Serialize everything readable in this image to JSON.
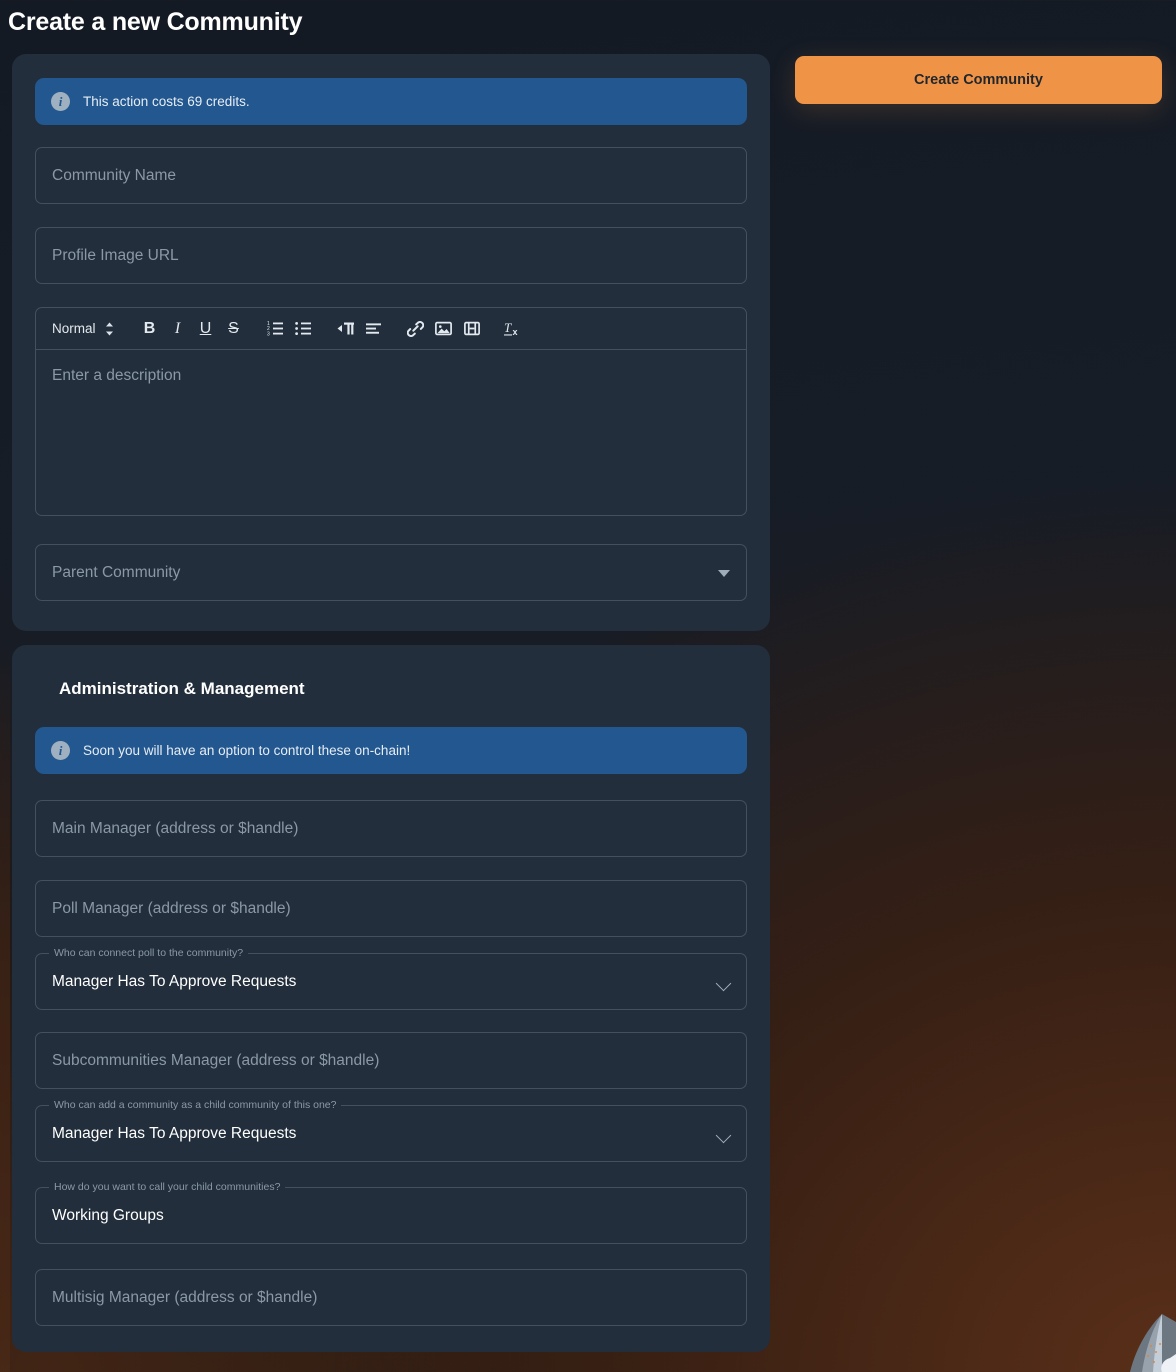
{
  "page": {
    "title": "Create a new Community"
  },
  "basics_card": {
    "info_banner": {
      "icon": "info-icon",
      "message": "This action costs 69 credits."
    },
    "community_name": {
      "placeholder": "Community Name",
      "value": ""
    },
    "profile_image_url": {
      "placeholder": "Profile Image URL",
      "value": ""
    },
    "description_editor": {
      "format_label": "Normal",
      "placeholder": "Enter a description",
      "value": "",
      "tools": [
        {
          "name": "format-select",
          "label": "Normal"
        },
        {
          "name": "bold-button",
          "label": "B"
        },
        {
          "name": "italic-button",
          "label": "I"
        },
        {
          "name": "underline-button",
          "label": "U"
        },
        {
          "name": "strikethrough-button",
          "label": "S"
        },
        {
          "name": "ordered-list-button",
          "label": "Ordered List"
        },
        {
          "name": "bullet-list-button",
          "label": "Bullet List"
        },
        {
          "name": "text-direction-button",
          "label": "Text Direction"
        },
        {
          "name": "align-button",
          "label": "Align"
        },
        {
          "name": "link-button",
          "label": "Link"
        },
        {
          "name": "image-button",
          "label": "Image"
        },
        {
          "name": "video-button",
          "label": "Video"
        },
        {
          "name": "clear-format-button",
          "label": "Clear Formatting"
        }
      ]
    },
    "parent_community": {
      "placeholder": "Parent Community",
      "value": ""
    }
  },
  "admin_card": {
    "section_title": "Administration & Management",
    "info_banner": {
      "icon": "info-icon",
      "message": "Soon you will have an option to control these on-chain!"
    },
    "main_manager": {
      "placeholder": "Main Manager (address or $handle)",
      "value": ""
    },
    "poll_manager": {
      "placeholder": "Poll Manager (address or $handle)",
      "value": ""
    },
    "poll_connect_policy": {
      "legend": "Who can connect poll to the community?",
      "value": "Manager Has To Approve Requests"
    },
    "subcommunities_manager": {
      "placeholder": "Subcommunities Manager (address or $handle)",
      "value": ""
    },
    "child_community_policy": {
      "legend": "Who can add a community as a child community of this one?",
      "value": "Manager Has To Approve Requests"
    },
    "child_community_name": {
      "legend": "How do you want to call your child communities?",
      "value": "Working Groups"
    },
    "multisig_manager": {
      "placeholder": "Multisig Manager (address or $handle)",
      "value": ""
    }
  },
  "actions": {
    "create_community_label": "Create Community"
  },
  "colors": {
    "accent": "#ef9447",
    "info_banner": "#23578f",
    "card_bg": "#222e3c",
    "page_bg": "#161d27"
  }
}
